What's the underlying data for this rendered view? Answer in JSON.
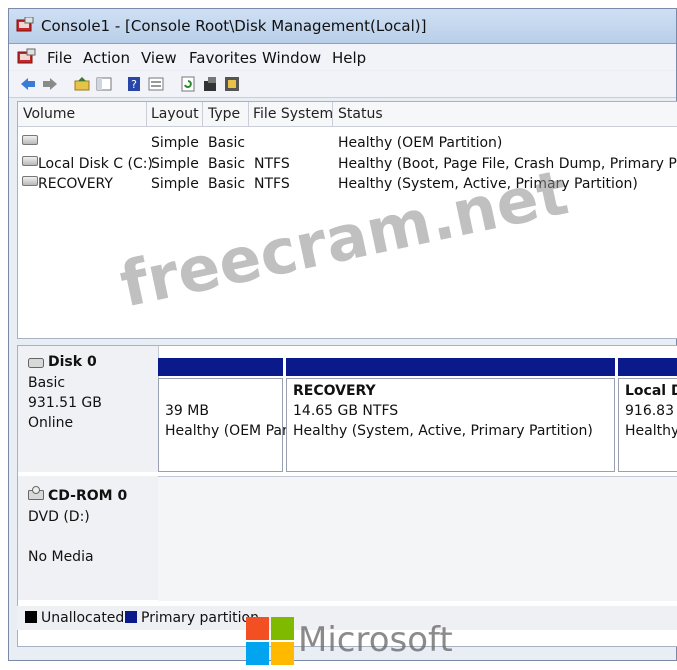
{
  "window": {
    "title": "Console1 - [Console Root\\Disk Management(Local)]"
  },
  "menu": {
    "items": [
      "File",
      "Action",
      "View",
      "Favorites",
      "Window",
      "Help"
    ]
  },
  "toolbar": {
    "icons": [
      "back-arrow-icon",
      "forward-arrow-icon",
      "up-folder-icon",
      "show-hide-tree-icon",
      "help-icon",
      "properties-icon",
      "refresh-icon",
      "export-icon",
      "settings-icon"
    ]
  },
  "volume_list": {
    "columns": [
      "Volume",
      "Layout",
      "Type",
      "File System",
      "Status"
    ],
    "rows": [
      {
        "volume": "",
        "layout": "Simple",
        "type": "Basic",
        "fs": "",
        "status": "Healthy (OEM Partition)"
      },
      {
        "volume": "Local Disk C (C:)",
        "layout": "Simple",
        "type": "Basic",
        "fs": "NTFS",
        "status": "Healthy (Boot, Page File, Crash Dump, Primary Partiti"
      },
      {
        "volume": "RECOVERY",
        "layout": "Simple",
        "type": "Basic",
        "fs": "NTFS",
        "status": "Healthy (System, Active, Primary Partition)"
      }
    ]
  },
  "disks": [
    {
      "name": "Disk 0",
      "type": "Basic",
      "size": "931.51 GB",
      "state": "Online",
      "partitions": [
        {
          "name": "",
          "size": "39 MB",
          "status": "Healthy (OEM Par"
        },
        {
          "name": "RECOVERY",
          "size": "14.65 GB NTFS",
          "status": "Healthy (System, Active, Primary Partition)"
        },
        {
          "name": "Local D",
          "size": "916.83 G",
          "status": "Healthy"
        }
      ]
    },
    {
      "name": "CD-ROM 0",
      "type": "DVD (D:)",
      "state": "No Media"
    }
  ],
  "legend": [
    {
      "label": "Unallocated",
      "color": "#000000"
    },
    {
      "label": "Primary partition",
      "color": "#0a1a8a"
    }
  ],
  "watermark": "freecram.net",
  "brand": "Microsoft"
}
